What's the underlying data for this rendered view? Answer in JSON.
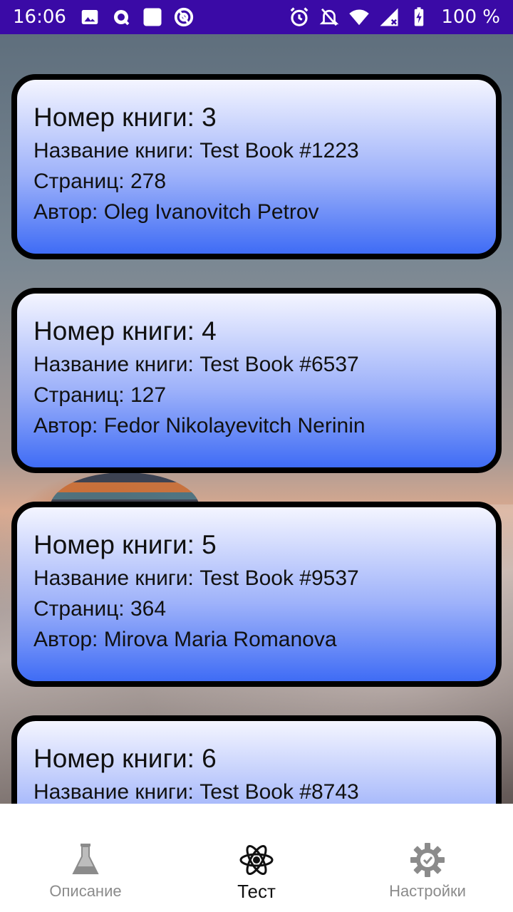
{
  "status_bar": {
    "time": "16:06",
    "battery": "100 %"
  },
  "books": [
    {
      "number_label": "Номер книги: 3",
      "title_label": "Название книги: Test Book #1223",
      "pages_label": "Страниц: 278",
      "author_label": "Автор: Oleg Ivanovitch Petrov"
    },
    {
      "number_label": "Номер книги: 4",
      "title_label": "Название книги: Test Book #6537",
      "pages_label": "Страниц: 127",
      "author_label": "Автор: Fedor Nikolayevitch  Nerinin"
    },
    {
      "number_label": "Номер книги: 5",
      "title_label": "Название книги: Test Book #9537",
      "pages_label": "Страниц: 364",
      "author_label": "Автор: Mirova Maria Romanova"
    },
    {
      "number_label": "Номер книги: 6",
      "title_label": "Название книги: Test Book #8743"
    }
  ],
  "bottom_nav": {
    "items": [
      {
        "label": "Описание",
        "icon": "flask-icon",
        "active": false
      },
      {
        "label": "Тест",
        "icon": "atom-icon",
        "active": true
      },
      {
        "label": "Настройки",
        "icon": "gear-check-icon",
        "active": false
      }
    ]
  },
  "colors": {
    "status_bar": "#3a0aa6",
    "card_gradient_top": "#f4f5ff",
    "card_gradient_bottom": "#3f6cf5",
    "card_border": "#000000",
    "nav_inactive": "#8b8b8b",
    "nav_active": "#111111"
  }
}
